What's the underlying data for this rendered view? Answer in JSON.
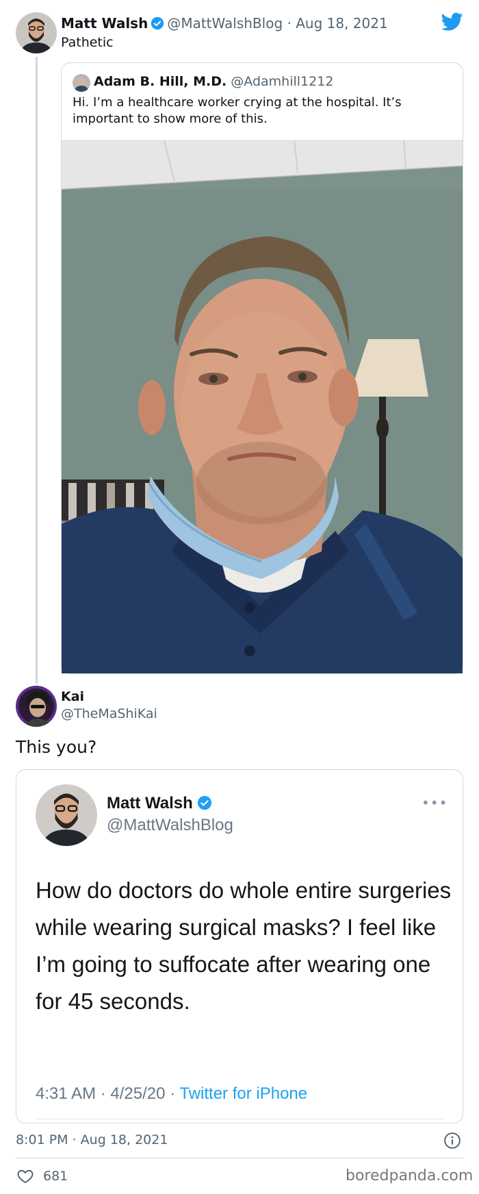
{
  "tweet": {
    "author_name": "Matt Walsh",
    "handle": "@MattWalshBlog",
    "separator": " · ",
    "date": "Aug 18, 2021",
    "text": "Pathetic",
    "icons": [
      "verified-badge-icon",
      "twitter-bird-icon"
    ]
  },
  "quoted_tweet": {
    "author_name": "Adam B. Hill, M.D.",
    "handle": "@Adamhill1212",
    "text": "Hi. I’m a healthcare worker crying at the hospital. It’s important to show more of this.",
    "media": "photo"
  },
  "reply": {
    "author_name": "Kai",
    "handle": "@TheMaShiKai",
    "text": "This you?",
    "timestamp": "8:01 PM · Aug 18, 2021",
    "likes": "681"
  },
  "embedded_screenshot": {
    "author_name": "Matt Walsh",
    "handle": "@MattWalshBlog",
    "more_label": "•••",
    "text": "How do doctors do whole entire surgeries while wearing surgical masks? I feel like I’m going to suffocate after wearing one for 45 seconds.",
    "time": "4:31 AM · 4/25/20 · ",
    "source": "Twitter for iPhone"
  },
  "watermark": "boredpanda.com",
  "colors": {
    "verified": "#1d9bf0",
    "link": "#1da1f2",
    "muted": "#536471"
  }
}
